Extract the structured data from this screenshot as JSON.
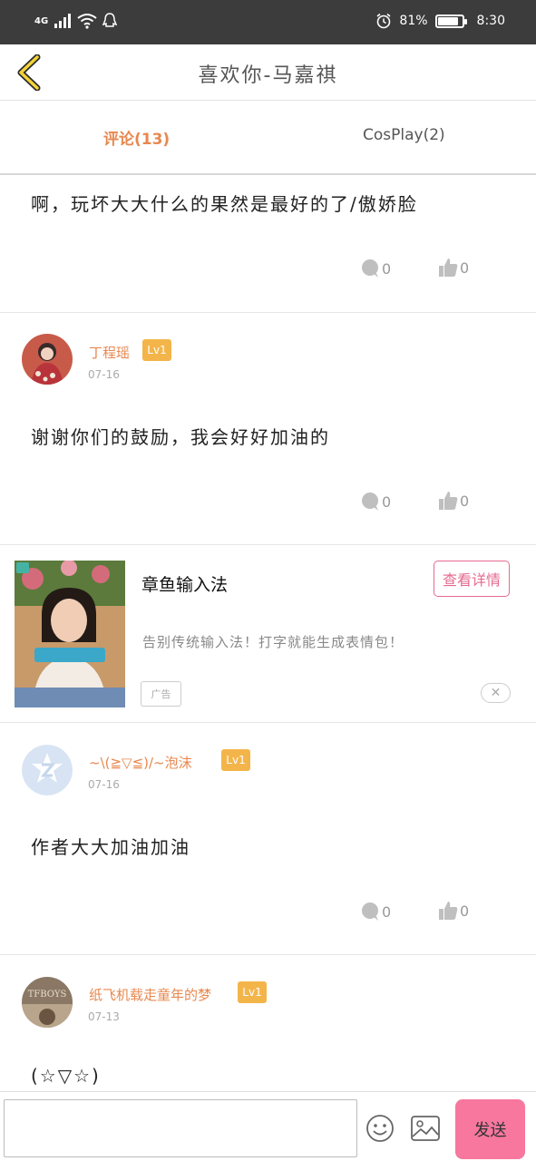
{
  "status": {
    "network": "4G",
    "battery_pct": "81%",
    "time": "8:30"
  },
  "nav": {
    "title": "喜欢你-马嘉祺"
  },
  "tabs": [
    {
      "label": "评论(13)"
    },
    {
      "label": "CosPlay(2)"
    }
  ],
  "comments": [
    {
      "text": "啊，玩坏大大什么的果然是最好的了/傲娇脸",
      "reply_count": "0",
      "like_count": "0"
    },
    {
      "username": "丁程瑶",
      "level": "Lv1",
      "date": "07-16",
      "text": "谢谢你们的鼓励，我会好好加油的",
      "reply_count": "0",
      "like_count": "0"
    },
    {
      "username": "~\\(≧▽≦)/~泡沫",
      "level": "Lv1",
      "date": "07-16",
      "text": "作者大大加油加油",
      "reply_count": "0",
      "like_count": "0"
    },
    {
      "username": "纸飞机载走童年的梦",
      "level": "Lv1",
      "date": "07-13",
      "avatar_text": "TFBOYS",
      "text": "(☆▽☆)"
    }
  ],
  "ad": {
    "title": "章鱼输入法",
    "description": "告别传统输入法！打字就能生成表情包！",
    "button": "查看详情",
    "tag": "广告",
    "close": "✕"
  },
  "bottom": {
    "send": "发送"
  },
  "colors": {
    "accent_orange": "#e8884f",
    "level_badge": "#f3b54a",
    "send_button": "#f7779f",
    "ad_button": "#e66a8f"
  }
}
